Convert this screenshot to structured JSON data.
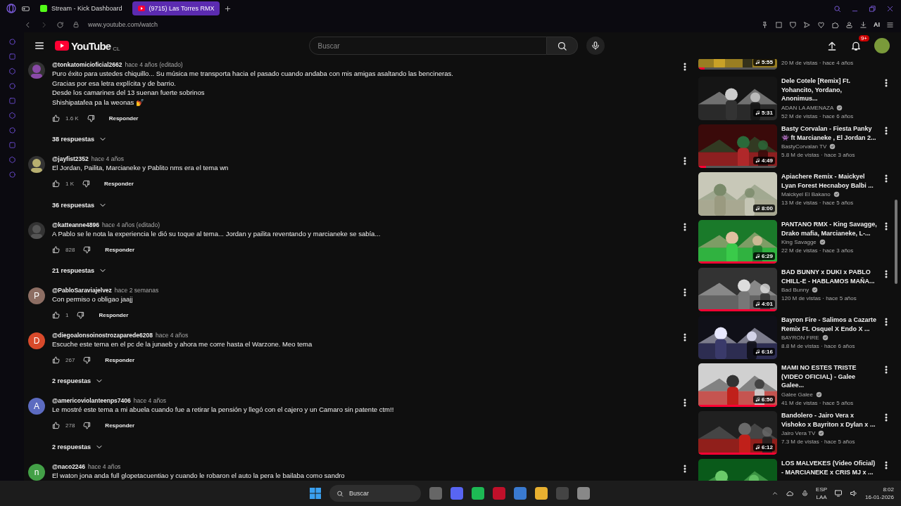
{
  "browser": {
    "tabs": [
      {
        "title": "Stream - Kick Dashboard",
        "selected": false
      },
      {
        "title": "(9715) Las Torres RMX",
        "selected": true
      }
    ],
    "url": "www.youtube.com/watch",
    "ai_label": "AI"
  },
  "header": {
    "logo": "YouTube",
    "region": "CL",
    "search": {
      "placeholder": "Buscar"
    },
    "notifications": "9+"
  },
  "comments": [
    {
      "avatar": {
        "kind": "picture",
        "color": "#8a4aa8"
      },
      "handle": "@tonkatomicioficial2662",
      "time": "hace 4 años (editado)",
      "lines": [
        "Puro éxito para ustedes chiquillo... Su música me transporta hacia el pasado cuando andaba con mis amigas asaltando las bencineras.",
        "Gracias por esa letra explícita y de barrio.",
        "Desde los camarines del 13 suenan fuerte sobrinos",
        "Shishipatafea pa la weonas 💅"
      ],
      "likes": "1.6 K",
      "reply": "Responder",
      "replies": "38 respuestas"
    },
    {
      "avatar": {
        "kind": "picture",
        "color": "#b8b070"
      },
      "handle": "@jayfist2352",
      "time": "hace 4 años",
      "lines": [
        "El Jordan, Pailita, Marcianeke y Pablito nms era el tema wn"
      ],
      "likes": "1 K",
      "reply": "Responder",
      "replies": "36 respuestas"
    },
    {
      "avatar": {
        "kind": "picture",
        "color": "#555555"
      },
      "handle": "@katteanne4896",
      "time": "hace 4 años (editado)",
      "lines": [
        "A Pablo se le nota la experiencia le dió su toque al tema... Jordan y pailita reventando y marcianeke se sabía..."
      ],
      "likes": "828",
      "reply": "Responder",
      "replies": "21 respuestas"
    },
    {
      "avatar": {
        "kind": "letter",
        "letter": "P",
        "color": "#8d6e63"
      },
      "handle": "@PabloSaraviajelvez",
      "time": "hace 2 semanas",
      "lines": [
        "Con permiso o obligao jaajj"
      ],
      "likes": "1",
      "reply": "Responder"
    },
    {
      "avatar": {
        "kind": "letter",
        "letter": "D",
        "color": "#d84a2b"
      },
      "handle": "@diegoalonsoinostrozaparede6208",
      "time": "hace 4 años",
      "lines": [
        "Escuche este tema en el pc de la junaeb y ahora me corre hasta el Warzone. Meo tema"
      ],
      "likes": "267",
      "reply": "Responder",
      "replies": "2 respuestas"
    },
    {
      "avatar": {
        "kind": "letter",
        "letter": "A",
        "color": "#5c6bc0"
      },
      "handle": "@americoviolanteenps7406",
      "time": "hace 4 años",
      "lines": [
        "Le mostré este tema a mi abuela cuando fue a retirar la pensión y llegó con el cajero y un Camaro sin patente ctm!!"
      ],
      "likes": "278",
      "reply": "Responder",
      "replies": "2 respuestas"
    },
    {
      "avatar": {
        "kind": "letter",
        "letter": "n",
        "color": "#43a047"
      },
      "handle": "@naco2246",
      "time": "hace 4 años",
      "lines": [
        "El waton jona anda full glopetacuentiao y cuando le robaron el auto la pera le bailaba como sandro"
      ]
    }
  ],
  "videos": [
    {
      "duration": "5:55",
      "stats": "20 M de vistas · hace 4 años",
      "level": 0.08
    },
    {
      "title": "Dele Cotele [Remix] Ft. Yohancito, Yordano, Anonimus...",
      "channel": "ADAN LA AMENAZA",
      "duration": "5:31",
      "stats": "52 M de vistas · hace 6 años"
    },
    {
      "title": "Basty Corvalan - Fiesta Panky 👾 ft Marcianeke , El Jordan 2...",
      "channel": "BastyCorvalan TV",
      "duration": "4:49",
      "stats": "5.8 M de vistas · hace 3 años",
      "level": 0.1
    },
    {
      "title": "Apiachere Remix - Maickyel Lyan Forest Hecnaboy Balbi ...",
      "channel": "Maickyel El Bakano",
      "duration": "8:00",
      "stats": "13 M de vistas · hace 5 años"
    },
    {
      "title": "PANTANO RMX - King Savagge, Drako mafia, Marcianeke, L-...",
      "channel": "King Savagge",
      "duration": "6:29",
      "stats": "22 M de vistas · hace 3 años",
      "level": 1
    },
    {
      "title": "BAD BUNNY x DUKI x PABLO CHILL-E - HABLAMOS MAÑA...",
      "channel": "Bad Bunny",
      "duration": "4:01",
      "stats": "120 M de vistas · hace 5 años",
      "level": 1
    },
    {
      "title": "Bayron Fire - Salimos a Cazarte Remix Ft. Osquel X Endo X ...",
      "channel": "BAYRON FIRE",
      "duration": "6:16",
      "stats": "8.8 M de vistas · hace 6 años"
    },
    {
      "title": "MAMI NO ESTES TRISTE (VIDEO OFICIAL) - Galee Galee...",
      "channel": "Galee Galee",
      "duration": "6:50",
      "stats": "41 M de vistas · hace 5 años",
      "level": 1
    },
    {
      "title": "Bandolero - Jairo Vera x Vishoko x Bayriton x Dylan x ...",
      "channel": "Jairo Vera TV",
      "duration": "6:12",
      "stats": "7.3 M de vistas · hace 5 años",
      "level": 1
    },
    {
      "title": "LOS MALVEKES (Video Oficial) - MARCIANEKE x CRIS MJ x ..."
    }
  ],
  "taskbar": {
    "search": {
      "placeholder": "Buscar"
    },
    "lang": "ESP",
    "layout": "LAA",
    "time": "8:02",
    "date": "16-01-2026"
  }
}
